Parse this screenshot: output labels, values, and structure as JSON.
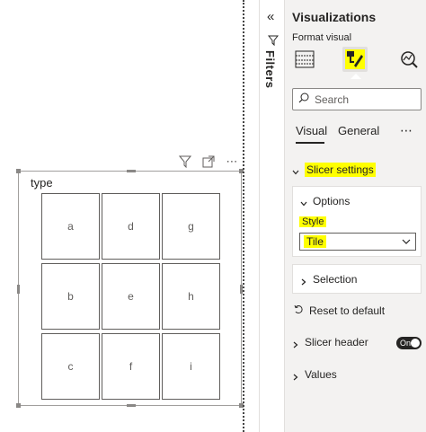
{
  "canvas": {
    "slicer": {
      "title": "type",
      "tiles": [
        "a",
        "d",
        "g",
        "b",
        "e",
        "h",
        "c",
        "f",
        "i"
      ]
    },
    "toolbar_icons": [
      "filter-icon",
      "focus-mode-icon",
      "more-options-icon"
    ],
    "more_label": "⋯"
  },
  "filters": {
    "label": "Filters",
    "collapse_glyph": "«"
  },
  "viz": {
    "collapse_glyph": "«",
    "title": "Visualizations",
    "subtitle": "Format visual",
    "icons": [
      "build-visual-icon",
      "format-visual-icon",
      "analytics-icon"
    ],
    "search": {
      "placeholder": "Search"
    },
    "tabs": {
      "visual": "Visual",
      "general": "General",
      "more": "⋯"
    },
    "sections": {
      "slicer_settings": "Slicer settings",
      "options": "Options",
      "style_label": "Style",
      "style_value": "Tile",
      "selection": "Selection",
      "reset": "Reset to default",
      "slicer_header": "Slicer header",
      "slicer_header_toggle": "On",
      "values": "Values"
    },
    "highlight_color": "#ffff00"
  }
}
